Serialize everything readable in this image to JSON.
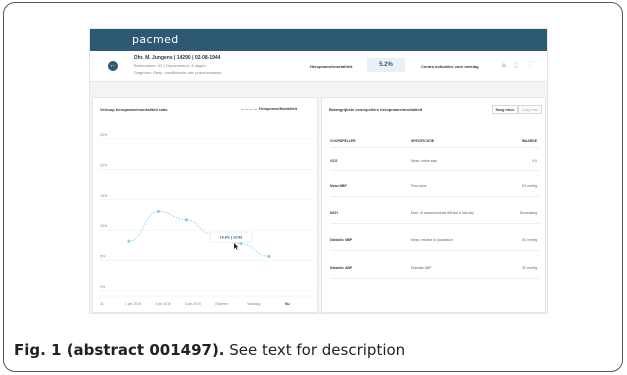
{
  "app": {
    "logo": "pacmed"
  },
  "patient": {
    "name_line": "Dhr. M. Jungens | 14290 | 02-08-1944",
    "line2": "Bednummer: 02 | Opnameduur: 4 dagen",
    "line3": "Diagnose: Resp. insufficientie obv pneumosepsis"
  },
  "summary": {
    "metric_label": "Heropname/mortaliteit",
    "metric_value": "5.2%",
    "contra_label": "Contra indicaties voor ontslag",
    "contra_icons": [
      "lungs-icon",
      "bottle-icon",
      "heart-icon"
    ]
  },
  "chart_panel": {
    "title": "Verloop heropname/mortaliteit ratio",
    "legend": "Heropname/Mortaliteit",
    "tooltip": "10.6% | 13:43"
  },
  "chart_data": {
    "type": "line",
    "title": "Verloop heropname/mortaliteit ratio",
    "xlabel": "",
    "ylabel": "",
    "y_ticks": [
      "25%",
      "20%",
      "15%",
      "10%",
      "5%",
      "0%"
    ],
    "ylim": [
      0,
      25
    ],
    "categories": [
      "31 jan 2019",
      "1 jan 2019",
      "2 jan 2019",
      "3 jan 2019",
      "Gisteren",
      "Vandaag",
      "Nu"
    ],
    "series": [
      {
        "name": "Heropname/Mortaliteit",
        "points": [
          {
            "x": 0.5,
            "y": 7.7
          },
          {
            "x": 1.55,
            "y": 12.6
          },
          {
            "x": 2.55,
            "y": 11.2
          },
          {
            "x": 3.45,
            "y": 8.9
          },
          {
            "x": 4.5,
            "y": 7.3
          },
          {
            "x": 5.5,
            "y": 5.2
          }
        ]
      }
    ],
    "grid": true,
    "legend_position": "top-right"
  },
  "predictors": {
    "title": "Belangrijkste voorspellers heropname/mortaliteit",
    "tabs": [
      {
        "label": "Hoog risico",
        "active": true
      },
      {
        "label": "Laag risico",
        "active": false
      }
    ],
    "columns": [
      "VOORSPELLER",
      "SPECIFICATIE",
      "WAARDE"
    ],
    "rows": [
      {
        "predictor": "GCS",
        "spec": "Mean, entire stay",
        "value": "9.0"
      },
      {
        "predictor": "Mean NBP",
        "spec": "First value",
        "value": "61 mmHg"
      },
      {
        "predictor": "MCH",
        "spec": "Num. of measurements diff last & first day",
        "value": "Decreasing"
      },
      {
        "predictor": "Diastolic NBP",
        "spec": "Mean, relative to population",
        "value": "50 mmHg"
      },
      {
        "predictor": "Diastolic ABP",
        "spec": "Diastolic ABP",
        "value": "20 mmHg"
      }
    ]
  },
  "caption": {
    "label": "Fig. 1 (abstract 001497).",
    "text": " See text for description"
  }
}
